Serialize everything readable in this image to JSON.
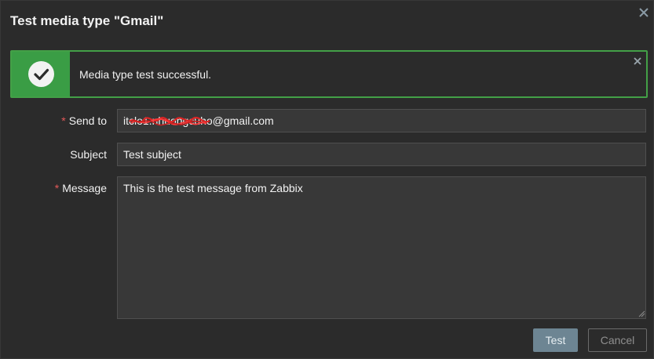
{
  "dialog": {
    "title": "Test media type \"Gmail\"",
    "close_icon": "close-icon"
  },
  "message": {
    "status": "success",
    "text": "Media type test successful.",
    "icon": "checkmark-circle-icon",
    "close_icon": "close-icon",
    "accent_color": "#3a9d45"
  },
  "form": {
    "send_to": {
      "label": "Send to",
      "required": true,
      "value": "itclo1.nhuongcuho@gmail.com"
    },
    "subject": {
      "label": "Subject",
      "required": false,
      "value": "Test subject"
    },
    "message": {
      "label": "Message",
      "required": true,
      "value": "This is the test message from Zabbix"
    },
    "required_marker": "*"
  },
  "buttons": {
    "test_label": "Test",
    "cancel_label": "Cancel"
  }
}
